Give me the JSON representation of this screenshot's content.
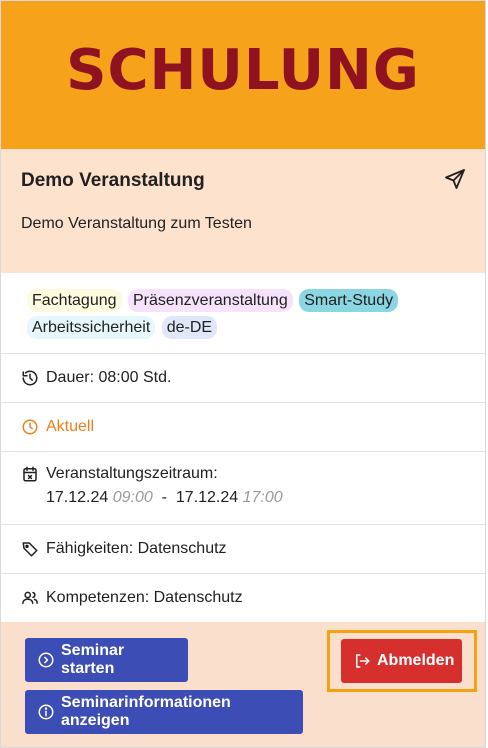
{
  "banner": {
    "text": "SCHULUNG"
  },
  "event": {
    "title": "Demo Veranstaltung",
    "description": "Demo Veranstaltung zum Testen"
  },
  "tags": [
    "Fachtagung",
    "Präsenzveranstaltung",
    "Smart-Study",
    "Arbeitssicherheit",
    "de-DE"
  ],
  "details": {
    "duration": "Dauer: 08:00 Std.",
    "status": "Aktuell",
    "period_label": "Veranstaltungszeitraum:",
    "start_date": "17.12.24",
    "start_time": "09:00",
    "separator": "-",
    "end_date": "17.12.24",
    "end_time": "17:00",
    "skills": "Fähigkeiten: Datenschutz",
    "competencies": "Kompetenzen: Datenschutz"
  },
  "actions": {
    "start_label": "Seminar starten",
    "info_label": "Seminarinformationen anzeigen",
    "unsubscribe_label": "Abmelden"
  },
  "colors": {
    "banner_bg": "#f6a21a",
    "banner_text": "#8f1220",
    "header_bg": "#fde2ce",
    "status": "#f07f1a",
    "primary_button": "#3d4db6",
    "danger_button": "#d6302e",
    "highlight_frame": "#f4a20f"
  },
  "icons": {
    "share": "send-icon",
    "duration": "history-icon",
    "status": "clock-icon",
    "period": "calendar-icon",
    "skills": "tag-icon",
    "competencies": "users-icon",
    "start": "play-circle-icon",
    "info": "info-circle-icon",
    "unsubscribe": "logout-icon"
  }
}
